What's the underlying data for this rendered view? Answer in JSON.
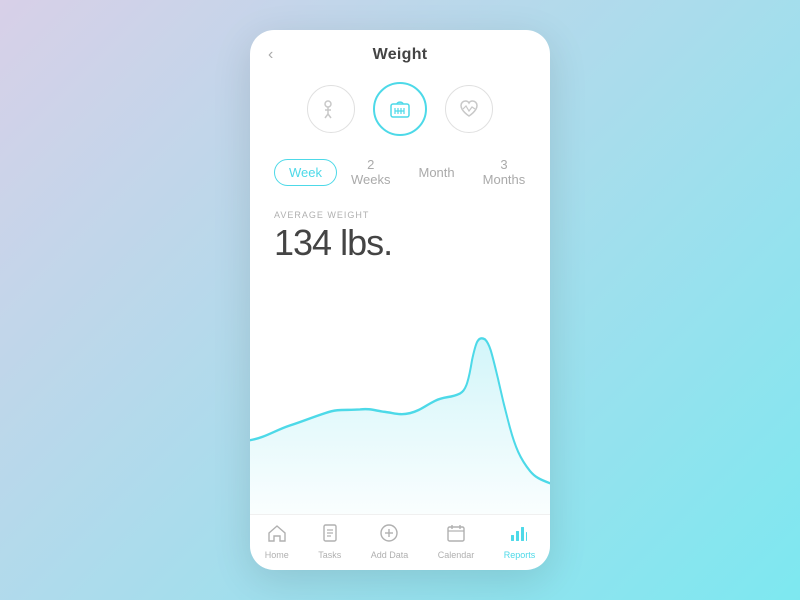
{
  "header": {
    "back_label": "‹",
    "title": "Weight"
  },
  "icons": [
    {
      "id": "activity",
      "symbol": "✦",
      "active": false
    },
    {
      "id": "weight-scale",
      "symbol": "⊞",
      "active": true
    },
    {
      "id": "heart-rate",
      "symbol": "♡",
      "active": false
    }
  ],
  "tabs": [
    {
      "id": "week",
      "label": "Week",
      "active": true
    },
    {
      "id": "2weeks",
      "label": "2 Weeks",
      "active": false
    },
    {
      "id": "month",
      "label": "Month",
      "active": false
    },
    {
      "id": "3months",
      "label": "3 Months",
      "active": false
    }
  ],
  "stats": {
    "avg_label": "AVERAGE WEIGHT",
    "avg_value": "134 lbs."
  },
  "chart": {
    "stroke_color": "#4dd9e8",
    "fill_color": "rgba(77,217,232,0.15)"
  },
  "bottom_nav": [
    {
      "id": "home",
      "symbol": "⌂",
      "label": "Home",
      "active": false
    },
    {
      "id": "tasks",
      "symbol": "☑",
      "label": "Tasks",
      "active": false
    },
    {
      "id": "add-data",
      "symbol": "⊕",
      "label": "Add Data",
      "active": false
    },
    {
      "id": "calendar",
      "symbol": "▦",
      "label": "Calendar",
      "active": false
    },
    {
      "id": "reports",
      "symbol": "▮",
      "label": "Reports",
      "active": true
    }
  ]
}
